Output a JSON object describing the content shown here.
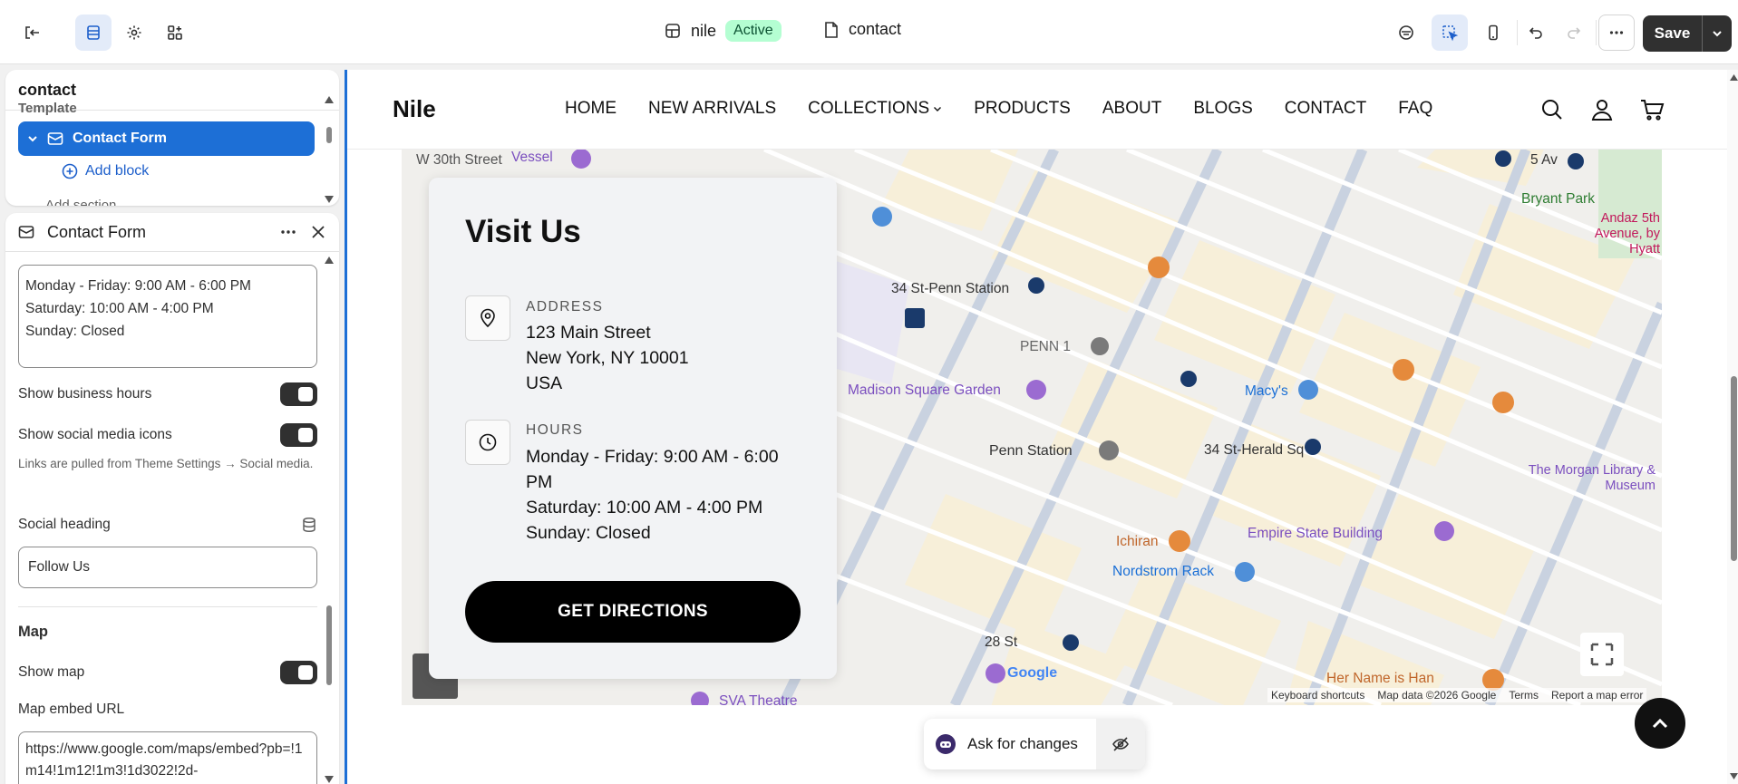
{
  "topbar": {
    "store_name": "nile",
    "store_status": "Active",
    "page_name": "contact",
    "save_label": "Save"
  },
  "sections_panel": {
    "title": "contact",
    "partial_top": "Template",
    "selected": "Contact Form",
    "add_block": "Add block",
    "partial_bottom": "Add section"
  },
  "settings_panel": {
    "title": "Contact Form",
    "hours_text": "Monday - Friday: 9:00 AM - 6:00 PM\nSaturday: 10:00 AM - 4:00 PM\nSunday: Closed",
    "show_business_hours": "Show business hours",
    "show_social": "Show social media icons",
    "social_help": "Links are pulled from Theme Settings → Social media.",
    "social_heading_label": "Social heading",
    "social_heading_value": "Follow Us",
    "map_heading": "Map",
    "show_map": "Show map",
    "map_url_label": "Map embed URL",
    "map_url_value": "https://www.google.com/maps/embed?pb=!1m14!1m12!1m3!1d3022!2d-"
  },
  "site": {
    "logo": "Nile",
    "nav": [
      "HOME",
      "NEW ARRIVALS",
      "COLLECTIONS",
      "PRODUCTS",
      "ABOUT",
      "BLOGS",
      "CONTACT",
      "FAQ"
    ]
  },
  "visit": {
    "heading": "Visit Us",
    "address_label": "ADDRESS",
    "address": "123 Main Street\nNew York, NY 10001\nUSA",
    "hours_label": "HOURS",
    "hours": "Monday - Friday: 9:00 AM - 6:00 PM\nSaturday: 10:00 AM - 4:00 PM\nSunday: Closed",
    "button": "GET DIRECTIONS"
  },
  "map": {
    "labels": {
      "penn_station_34": "34 St-Penn Station",
      "penn1": "PENN 1",
      "msg": "Madison Square Garden",
      "penn_station": "Penn Station",
      "macys": "Macy's",
      "herald": "34 St-Herald Sq",
      "bryant": "Bryant Park",
      "andaz": "Andaz 5th Avenue, by Hyatt",
      "morgan": "The Morgan Library & Museum",
      "esb": "Empire State Building",
      "ichiran": "Ichiran",
      "nordstrom": "Nordstrom Rack",
      "st28": "28 St",
      "vessel": "Vessel",
      "sva": "SVA Theatre",
      "herName": "Her Name is Han",
      "fifthAv": "5 Av",
      "st30": "W 30th Street"
    },
    "footer": [
      "Keyboard shortcuts",
      "Map data ©2026 Google",
      "Terms",
      "Report a map error"
    ],
    "google": "Google"
  },
  "ask_changes": "Ask for changes",
  "colors": {
    "accent": "#1d6fd6",
    "active_badge": "#b4fed2",
    "button_dark": "#000000"
  }
}
